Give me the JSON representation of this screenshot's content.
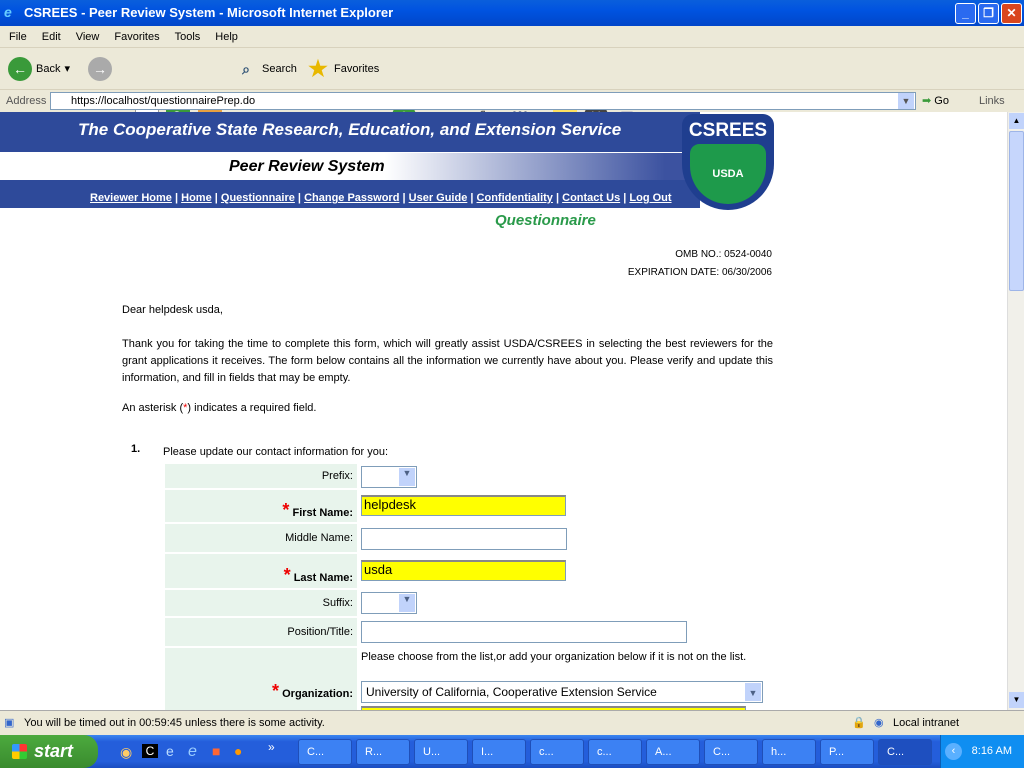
{
  "window": {
    "title": "CSREES - Peer Review System - Microsoft Internet Explorer"
  },
  "menu": [
    "File",
    "Edit",
    "View",
    "Favorites",
    "Tools",
    "Help"
  ],
  "toolbar": {
    "back": "Back",
    "search": "Search",
    "favorites": "Favorites"
  },
  "address": {
    "label": "Address",
    "url": "https://localhost/questionnairePrep.do",
    "go": "Go",
    "links": "Links"
  },
  "header": {
    "agency": "The Cooperative State Research, Education, and Extension Service",
    "system": "Peer Review System",
    "logo_text": "CSREES",
    "logo_sub": "USDA",
    "nav": [
      "Reviewer Home",
      "Home",
      "Questionnaire",
      "Change Password",
      "User Guide",
      "Confidentiality",
      "Contact Us",
      "Log Out"
    ]
  },
  "page": {
    "title": "Questionnaire",
    "omb": "OMB NO.: 0524-0040",
    "expiration": "EXPIRATION DATE: 06/30/2006",
    "greeting": "Dear helpdesk usda,",
    "intro": "Thank you for taking the time to complete this form, which will greatly assist USDA/CSREES in selecting the best reviewers for the grant applications it receives. The form below contains all the information we currently have about you. Please verify and update this information, and fill in fields that may be empty.",
    "asterisk_pre": "An asterisk (",
    "asterisk": "*",
    "asterisk_post": ") indicates a required field.",
    "q_num": "1.",
    "q_text": "Please update our contact information for you:"
  },
  "form": {
    "prefix": "Prefix:",
    "first_name": "First Name:",
    "first_value": "helpdesk",
    "middle_name": "Middle Name:",
    "last_name": "Last Name:",
    "last_value": "usda",
    "suffix": "Suffix:",
    "position": "Position/Title:",
    "organization": "Organization:",
    "org_hint": "Please choose from the list,or add your organization below if it is not on the list.",
    "org_value": "University of California, Cooperative Extension Service"
  },
  "status": {
    "text": "You will be timed out in 00:59:45 unless there is some activity.",
    "zone": "Local intranet"
  },
  "taskbar": {
    "start": "start",
    "tasks": [
      "C...",
      "R...",
      "U...",
      "I...",
      "c...",
      "c...",
      "A...",
      "C...",
      "h...",
      "P...",
      "C..."
    ],
    "clock": "8:16 AM"
  }
}
